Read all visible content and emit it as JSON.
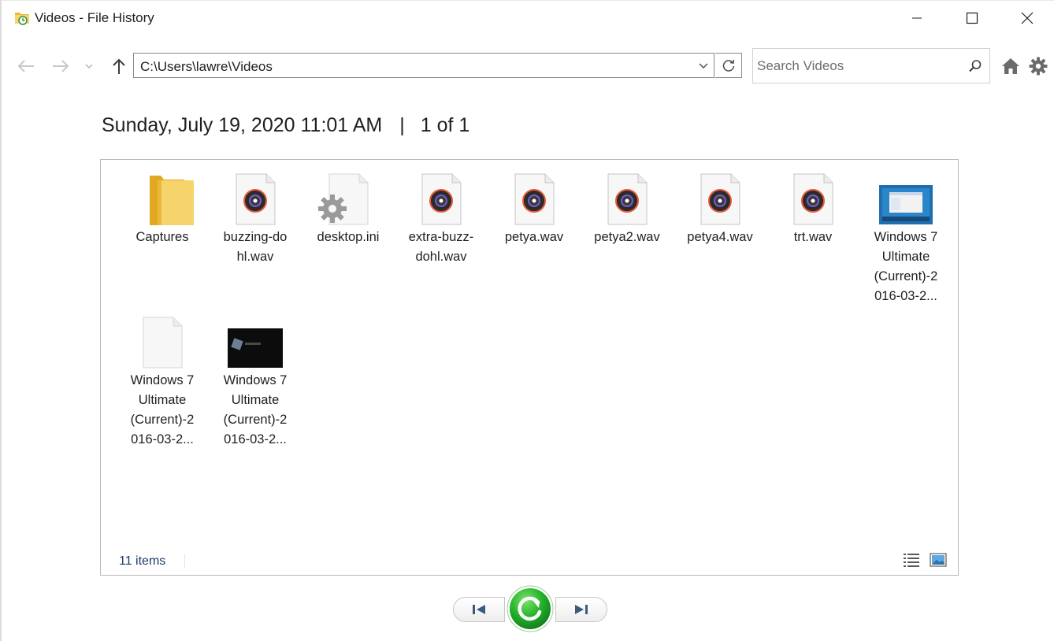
{
  "window": {
    "title": "Videos - File History"
  },
  "navigation": {
    "address_path": "C:\\Users\\lawre\\Videos",
    "search_placeholder": "Search Videos"
  },
  "snapshot": {
    "datetime": "Sunday, July 19, 2020 11:01 AM",
    "separator": "|",
    "position": "1 of 1"
  },
  "items": [
    {
      "name": "Captures",
      "type": "folder"
    },
    {
      "name": "buzzing-dohl.wav",
      "type": "audio"
    },
    {
      "name": "desktop.ini",
      "type": "settings"
    },
    {
      "name": "extra-buzz-dohl.wav",
      "type": "audio"
    },
    {
      "name": "petya.wav",
      "type": "audio"
    },
    {
      "name": "petya2.wav",
      "type": "audio"
    },
    {
      "name": "petya4.wav",
      "type": "audio"
    },
    {
      "name": "trt.wav",
      "type": "audio"
    },
    {
      "name": "Windows 7 Ultimate (Current)-2016-03-2...",
      "type": "video-blue"
    },
    {
      "name": "Windows 7 Ultimate (Current)-2016-03-2...",
      "type": "blank"
    },
    {
      "name": "Windows 7 Ultimate (Current)-2016-03-2...",
      "type": "video-dark"
    }
  ],
  "item_labels": [
    [
      "Captures"
    ],
    [
      "buzzing-do",
      "hl.wav"
    ],
    [
      "desktop.ini"
    ],
    [
      "extra-buzz-",
      "dohl.wav"
    ],
    [
      "petya.wav"
    ],
    [
      "petya2.wav"
    ],
    [
      "petya4.wav"
    ],
    [
      "trt.wav"
    ],
    [
      "Windows 7",
      "Ultimate",
      "(Current)-2",
      "016-03-2..."
    ],
    [
      "Windows 7",
      "Ultimate",
      "(Current)-2",
      "016-03-2..."
    ],
    [
      "Windows 7",
      "Ultimate",
      "(Current)-2",
      "016-03-2..."
    ]
  ],
  "status": {
    "item_count": "11 items"
  },
  "colors": {
    "folder": "#f3c84b",
    "restore_green": "#1fae2a",
    "status_text": "#1f3a6e"
  },
  "icons": {
    "back": "arrow-left-icon",
    "forward": "arrow-right-icon",
    "up": "arrow-up-icon",
    "refresh": "refresh-icon",
    "search": "search-icon",
    "home": "home-icon",
    "settings": "gear-icon",
    "previous": "previous-version-icon",
    "restore": "restore-icon",
    "next": "next-version-icon"
  }
}
